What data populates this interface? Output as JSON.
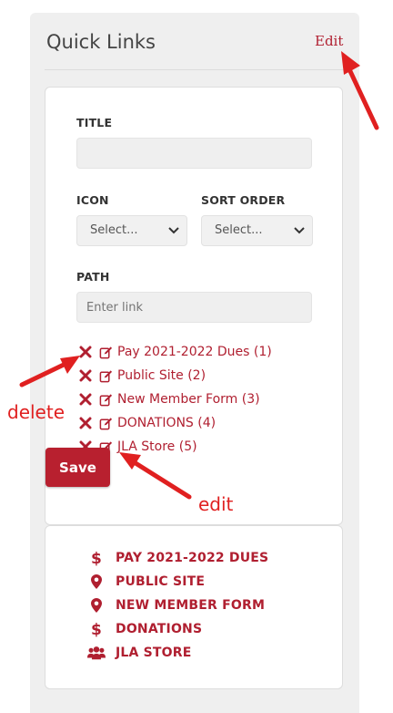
{
  "panel": {
    "title": "Quick Links",
    "edit_label": "Edit"
  },
  "form": {
    "title_label": "TITLE",
    "title_value": "",
    "icon_label": "ICON",
    "icon_value": "Select...",
    "sort_label": "SORT ORDER",
    "sort_value": "Select...",
    "path_label": "PATH",
    "path_placeholder": "Enter link",
    "save_label": "Save"
  },
  "editable_links": [
    {
      "label": "Pay 2021-2022 Dues (1)"
    },
    {
      "label": "Public Site (2)"
    },
    {
      "label": "New Member Form (3)"
    },
    {
      "label": "DONATIONS (4)"
    },
    {
      "label": "JLA Store (5)"
    }
  ],
  "quick_links": [
    {
      "label": "PAY 2021-2022 DUES",
      "icon": "dollar-icon"
    },
    {
      "label": "PUBLIC SITE",
      "icon": "map-marker-icon"
    },
    {
      "label": "NEW MEMBER FORM",
      "icon": "map-marker-icon"
    },
    {
      "label": "DONATIONS",
      "icon": "dollar-icon"
    },
    {
      "label": "JLA STORE",
      "icon": "users-icon"
    }
  ],
  "annotations": {
    "delete": "delete",
    "edit": "edit"
  },
  "colors": {
    "accent": "#b01f30",
    "button": "#b8202f",
    "annotation": "#e02020",
    "panel": "#efefef"
  }
}
